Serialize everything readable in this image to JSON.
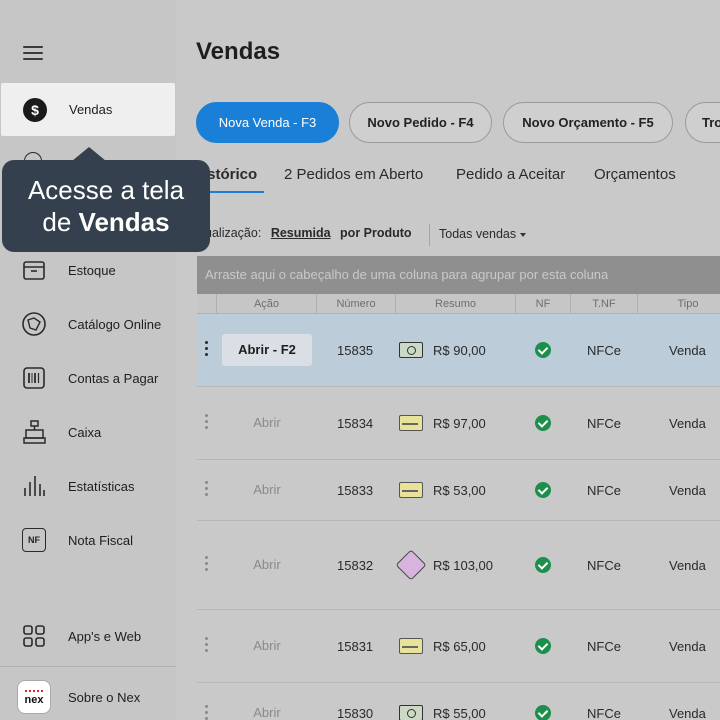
{
  "sidebar": {
    "items": [
      {
        "label": "Vendas",
        "icon": "dollar-icon"
      },
      {
        "label": "Estoque",
        "icon": "box-icon"
      },
      {
        "label": "Catálogo Online",
        "icon": "catalog-icon"
      },
      {
        "label": "Contas a Pagar",
        "icon": "barcode-icon"
      },
      {
        "label": "Caixa",
        "icon": "cash-register-icon"
      },
      {
        "label": "Estatísticas",
        "icon": "bar-chart-icon"
      },
      {
        "label": "Nota Fiscal",
        "icon": "nf-icon"
      },
      {
        "label": "App's e Web",
        "icon": "apps-grid-icon"
      },
      {
        "label": "Sobre o Nex",
        "icon": "nex-logo"
      }
    ],
    "nf_badge": "NF",
    "nex_text": "nex"
  },
  "tooltip": {
    "line1": "Acesse a tela",
    "prefix": "de ",
    "bold": "Vendas"
  },
  "main": {
    "title": "Vendas",
    "actions": [
      "Nova Venda - F3",
      "Novo Pedido - F4",
      "Novo Orçamento - F5",
      "Tro"
    ],
    "tabs": [
      "istórico",
      "2 Pedidos em Aberto",
      "Pedido a Aceitar",
      "Orçamentos"
    ],
    "view": {
      "label": "isualização:",
      "selected": "Resumida",
      "other": "por Produto",
      "filter": "Todas vendas"
    },
    "group_hint": "Arraste aqui o cabeçalho de uma coluna para agrupar por esta coluna",
    "columns": [
      "Ação",
      "Número",
      "Resumo",
      "NF",
      "T.NF",
      "Tipo"
    ],
    "rows": [
      {
        "action": "Abrir - F2",
        "number": "15835",
        "payment": "cash",
        "amount": "R$ 90,00",
        "nf": true,
        "tnf": "NFCe",
        "type": "Venda",
        "selected": true
      },
      {
        "action": "Abrir",
        "number": "15834",
        "payment": "card",
        "amount": "R$ 97,00",
        "nf": true,
        "tnf": "NFCe",
        "type": "Venda"
      },
      {
        "action": "Abrir",
        "number": "15833",
        "payment": "card",
        "amount": "R$ 53,00",
        "nf": true,
        "tnf": "NFCe",
        "type": "Venda"
      },
      {
        "action": "Abrir",
        "number": "15832",
        "payment": "pix",
        "amount": "R$ 103,00",
        "nf": true,
        "tnf": "NFCe",
        "type": "Venda"
      },
      {
        "action": "Abrir",
        "number": "15831",
        "payment": "card",
        "amount": "R$ 65,00",
        "nf": true,
        "tnf": "NFCe",
        "type": "Venda"
      },
      {
        "action": "Abrir",
        "number": "15830",
        "payment": "cash",
        "amount": "R$ 55,00",
        "nf": true,
        "tnf": "NFCe",
        "type": "Venda"
      }
    ]
  },
  "colors": {
    "accent": "#1a7fd6",
    "tooltip_bg": "#34404d",
    "check": "#1c8f4a",
    "selected_row": "#bcccd9"
  }
}
